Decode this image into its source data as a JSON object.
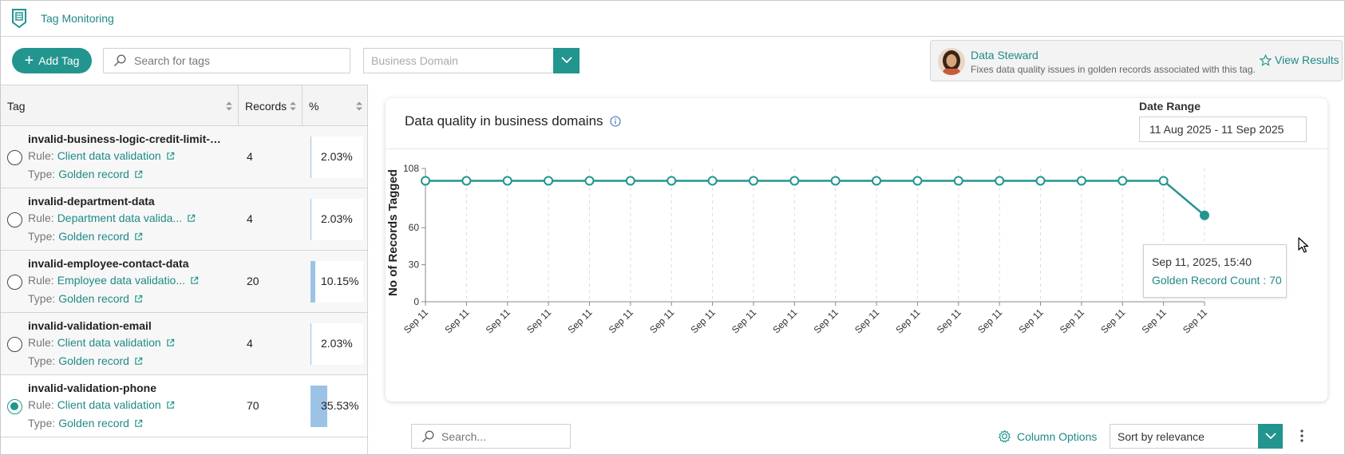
{
  "app": {
    "title": "Tag Monitoring"
  },
  "toolbar": {
    "add_tag_label": "Add Tag",
    "search_placeholder": "Search for tags",
    "domain_placeholder": "Business Domain"
  },
  "steward": {
    "role": "Data Steward",
    "description": "Fixes data quality issues in golden records associated with this tag.",
    "view_label": "View Results"
  },
  "table": {
    "headers": {
      "tag": "Tag",
      "records": "Records",
      "percent": "%"
    },
    "rule_prefix": "Rule:",
    "type_prefix": "Type:",
    "rows": [
      {
        "name": "invalid-business-logic-credit-limit-mis...",
        "rule": "Client data validation",
        "type": "Golden record",
        "records": "4",
        "percent": "2.03%",
        "fraction": 0.0203,
        "selected": false
      },
      {
        "name": "invalid-department-data",
        "rule": "Department data valida...",
        "type": "Golden record",
        "records": "4",
        "percent": "2.03%",
        "fraction": 0.0203,
        "selected": false
      },
      {
        "name": "invalid-employee-contact-data",
        "rule": "Employee data validatio...",
        "type": "Golden record",
        "records": "20",
        "percent": "10.15%",
        "fraction": 0.1015,
        "selected": false
      },
      {
        "name": "invalid-validation-email",
        "rule": "Client data validation",
        "type": "Golden record",
        "records": "4",
        "percent": "2.03%",
        "fraction": 0.0203,
        "selected": false
      },
      {
        "name": "invalid-validation-phone",
        "rule": "Client data validation",
        "type": "Golden record",
        "records": "70",
        "percent": "35.53%",
        "fraction": 0.3553,
        "selected": true
      }
    ]
  },
  "card": {
    "title": "Data quality in business domains",
    "date_range_label": "Date Range",
    "date_range_value": "11 Aug 2025 - 11 Sep 2025"
  },
  "tooltip": {
    "date": "Sep 11, 2025, 15:40",
    "value_label": "Golden Record Count : 70"
  },
  "bottom": {
    "search_placeholder": "Search...",
    "column_options_label": "Column Options",
    "sort_value": "Sort by relevance"
  },
  "colors": {
    "accent": "#23958f",
    "bar": "#9cc3e6"
  },
  "chart_data": {
    "type": "line",
    "ylabel": "No of Records Tagged",
    "xlabel": "",
    "categories": [
      "Sep 11",
      "Sep 11",
      "Sep 11",
      "Sep 11",
      "Sep 11",
      "Sep 11",
      "Sep 11",
      "Sep 11",
      "Sep 11",
      "Sep 11",
      "Sep 11",
      "Sep 11",
      "Sep 11",
      "Sep 11",
      "Sep 11",
      "Sep 11",
      "Sep 11",
      "Sep 11",
      "Sep 11",
      "Sep 11"
    ],
    "values": [
      98,
      98,
      98,
      98,
      98,
      98,
      98,
      98,
      98,
      98,
      98,
      98,
      98,
      98,
      98,
      98,
      98,
      98,
      98,
      70
    ],
    "yticks": [
      0,
      30,
      60,
      108
    ],
    "ylim": [
      0,
      108
    ],
    "grid": "vertical dashed",
    "color": "#23958f"
  }
}
